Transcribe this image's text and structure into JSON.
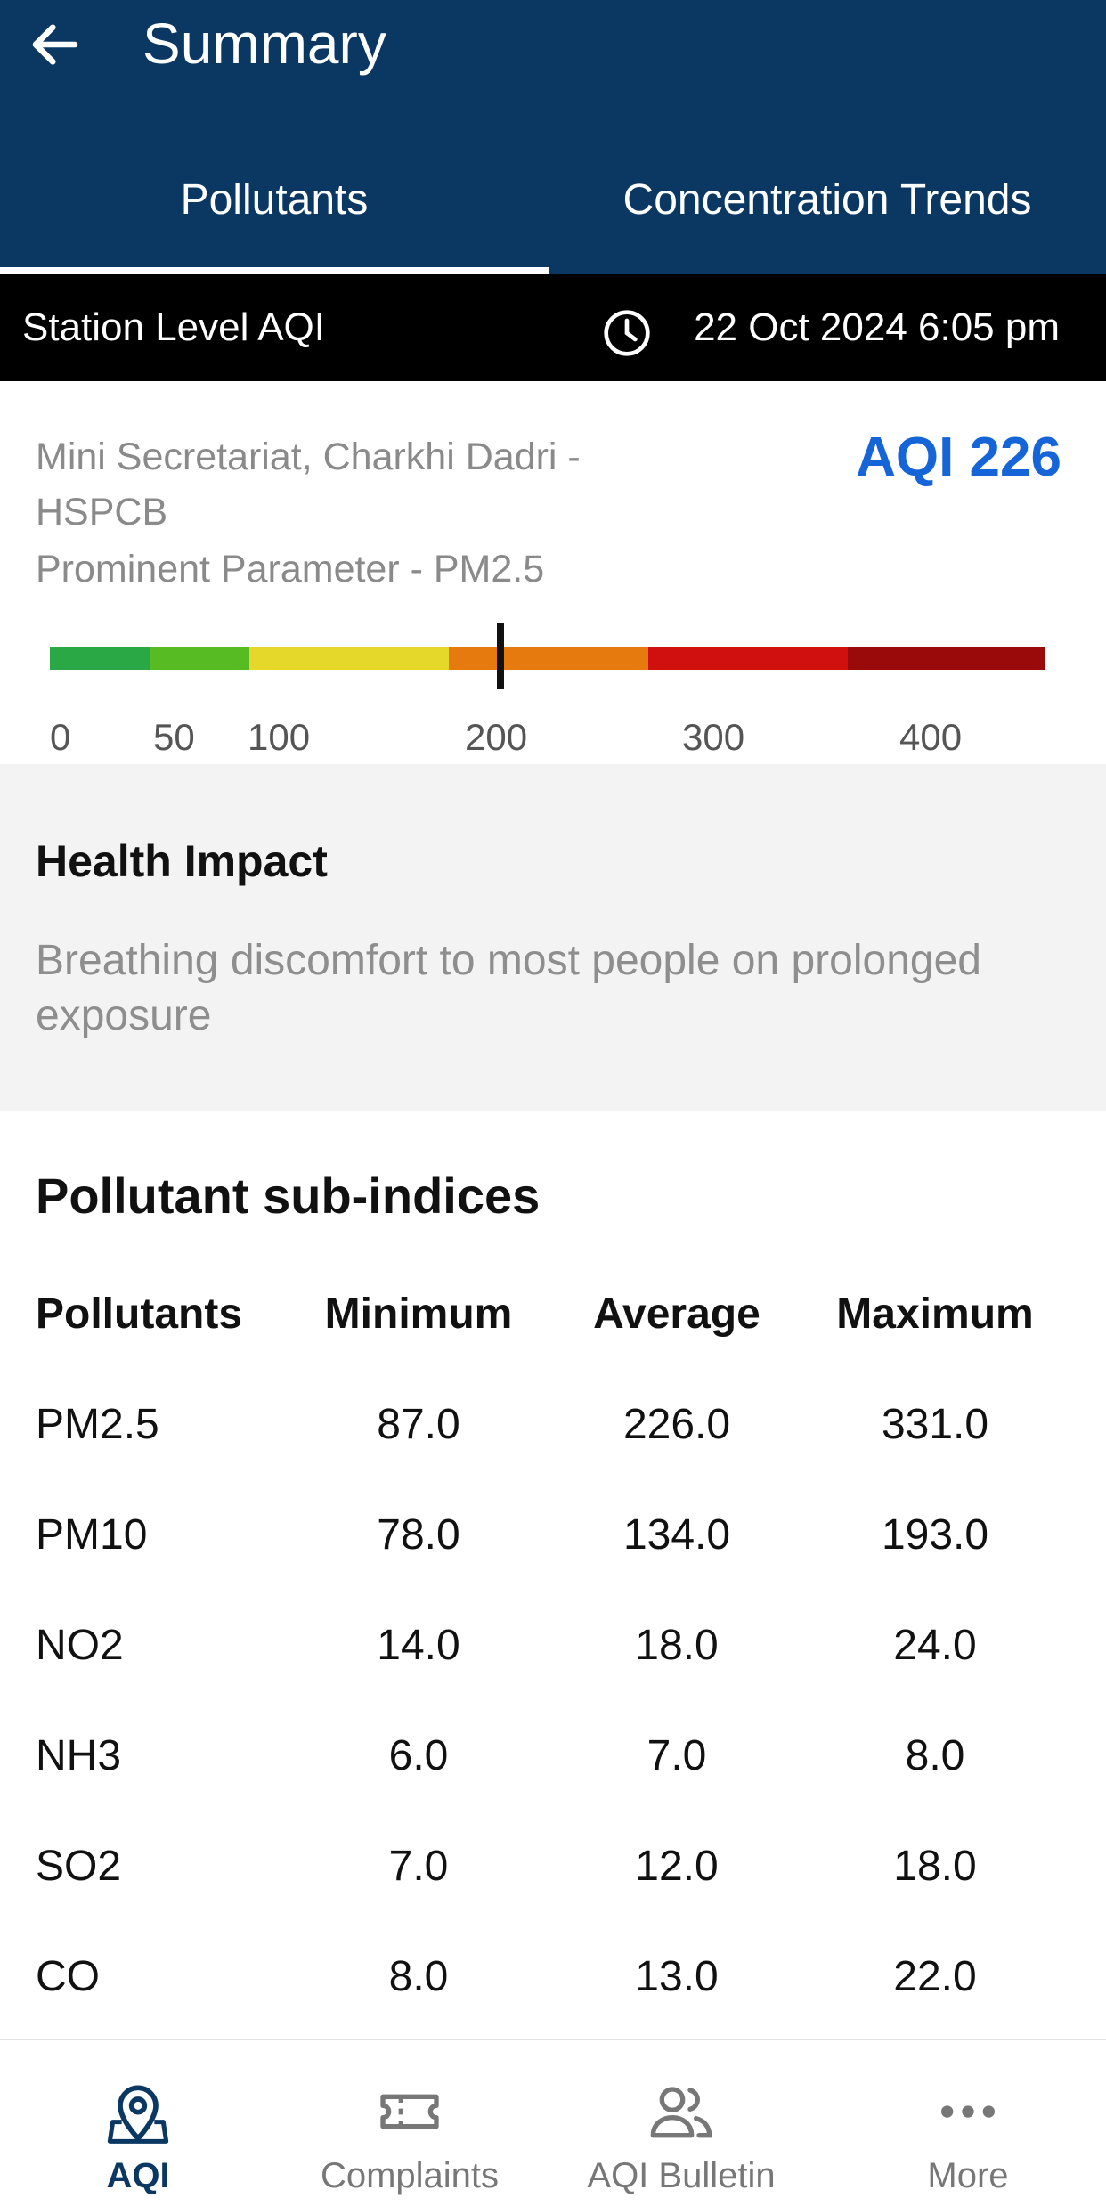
{
  "header": {
    "title": "Summary",
    "tabs": [
      {
        "label": "Pollutants",
        "active": true
      },
      {
        "label": "Concentration Trends",
        "active": false
      }
    ]
  },
  "status_strip": {
    "label": "Station Level AQI",
    "timestamp": "22 Oct 2024 6:05 pm"
  },
  "station": {
    "name_line1": "Mini Secretariat, Charkhi Dadri -",
    "name_line2": "HSPCB",
    "prominent": "Prominent Parameter - PM2.5",
    "aqi_label": "AQI 226",
    "aqi_value": 226,
    "scale_colors": [
      "#2aa845",
      "#57bb24",
      "#e6d82a",
      "#e67a0f",
      "#d00f0f",
      "#9a0a0a"
    ],
    "scale_ticks": [
      "0",
      "50",
      "100",
      "200",
      "300",
      "400"
    ]
  },
  "health": {
    "title": "Health Impact",
    "text": "Breathing discomfort to most people on prolonged exposure"
  },
  "table": {
    "title": "Pollutant sub-indices",
    "headers": [
      "Pollutants",
      "Minimum",
      "Average",
      "Maximum"
    ],
    "rows": [
      [
        "PM2.5",
        "87.0",
        "226.0",
        "331.0"
      ],
      [
        "PM10",
        "78.0",
        "134.0",
        "193.0"
      ],
      [
        "NO2",
        "14.0",
        "18.0",
        "24.0"
      ],
      [
        "NH3",
        "6.0",
        "7.0",
        "8.0"
      ],
      [
        "SO2",
        "7.0",
        "12.0",
        "18.0"
      ],
      [
        "CO",
        "8.0",
        "13.0",
        "22.0"
      ]
    ]
  },
  "nav": {
    "items": [
      {
        "label": "AQI",
        "icon": "map-pin-icon",
        "active": true
      },
      {
        "label": "Complaints",
        "icon": "ticket-icon",
        "active": false
      },
      {
        "label": "AQI Bulletin",
        "icon": "users-icon",
        "active": false
      },
      {
        "label": "More",
        "icon": "more-dots-icon",
        "active": false
      }
    ]
  }
}
